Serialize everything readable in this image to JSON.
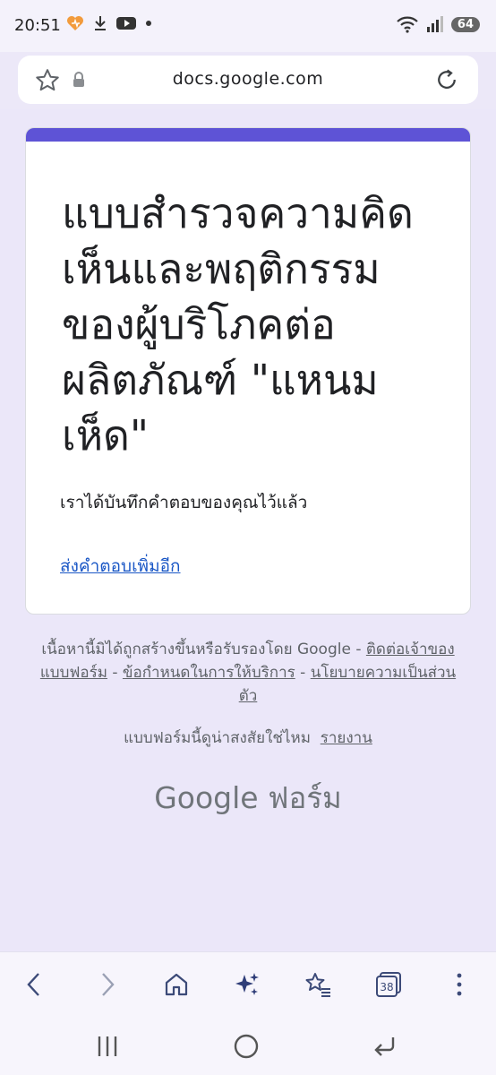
{
  "status_bar": {
    "time": "20:51",
    "battery": "64",
    "icons": [
      "heart-app-icon",
      "download-icon",
      "youtube-icon",
      "dot-icon",
      "wifi-icon",
      "signal-icon"
    ]
  },
  "browser": {
    "url": "docs.google.com"
  },
  "form": {
    "accent_color": "#5e53d6",
    "title": "แบบสำรวจความคิดเห็นและพฤติกรรมของผู้บริโภคต่อผลิตภัณฑ์ \"แหนมเห็ด\"",
    "confirmation": "เราได้บันทึกคำตอบของคุณไว้แล้ว",
    "submit_another": "ส่งคำตอบเพิ่มอีก"
  },
  "footer": {
    "disclaimer": "เนื้อหานี้มิได้ถูกสร้างขึ้นหรือรับรองโดย Google - ",
    "contact_owner": "ติดต่อเจ้าของแบบฟอร์ม",
    "sep1": " - ",
    "terms": "ข้อกำหนดในการให้บริการ",
    "sep2": " - ",
    "privacy": "นโยบายความเป็นส่วนตัว",
    "suspicious": "แบบฟอร์มนี้ดูน่าสงสัยใช่ไหม",
    "report": "รายงาน",
    "brand_google": "Google",
    "brand_forms": "ฟอร์ม"
  },
  "toolbar": {
    "tab_count": "38"
  }
}
